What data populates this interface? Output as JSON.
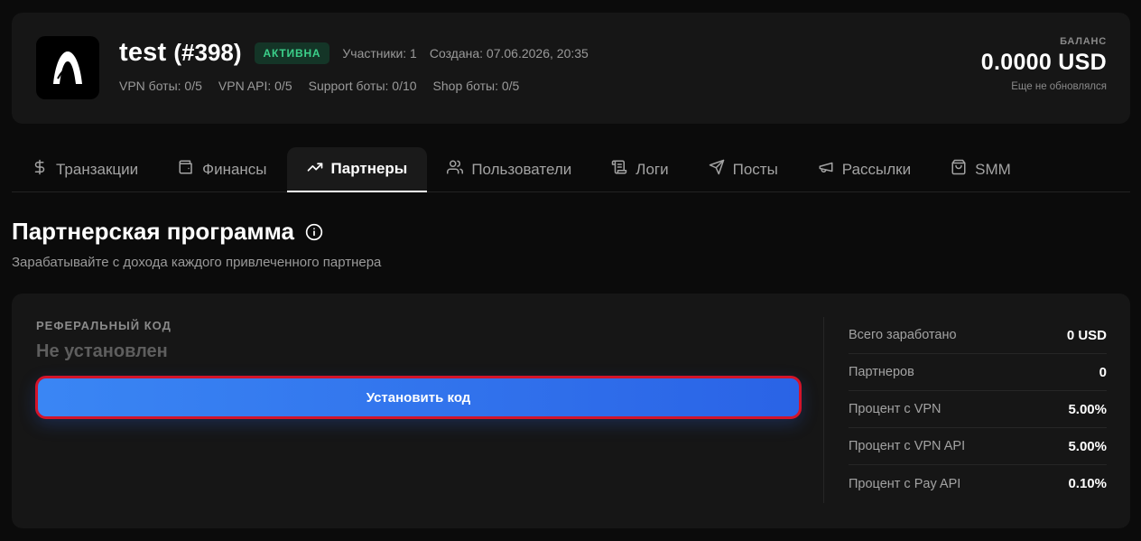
{
  "project": {
    "name": "test",
    "id": "(#398)",
    "status": "АКТИВНА",
    "members": "Участники: 1",
    "created": "Создана: 07.06.2026, 20:35",
    "limits": [
      "VPN боты: 0/5",
      "VPN API: 0/5",
      "Support боты: 0/10",
      "Shop боты: 0/5"
    ],
    "logo_icon": "arch-logo-icon"
  },
  "balance": {
    "label": "БАЛАНС",
    "value": "0.0000 USD",
    "note": "Еще не обновлялся"
  },
  "tabs": [
    {
      "label": "Транзакции",
      "icon": "dollar-icon",
      "active": false
    },
    {
      "label": "Финансы",
      "icon": "wallet-icon",
      "active": false
    },
    {
      "label": "Партнеры",
      "icon": "trending-up-icon",
      "active": true
    },
    {
      "label": "Пользователи",
      "icon": "users-icon",
      "active": false
    },
    {
      "label": "Логи",
      "icon": "scroll-icon",
      "active": false
    },
    {
      "label": "Посты",
      "icon": "send-icon",
      "active": false
    },
    {
      "label": "Рассылки",
      "icon": "megaphone-icon",
      "active": false
    },
    {
      "label": "SMM",
      "icon": "shopping-bag-icon",
      "active": false
    }
  ],
  "section": {
    "title": "Партнерская программа",
    "subtitle": "Зарабатывайте с дохода каждого привлеченного партнера",
    "info_icon": "info-icon"
  },
  "referral": {
    "label": "РЕФЕРАЛЬНЫЙ КОД",
    "value": "Не установлен",
    "button_label": "Установить код"
  },
  "stats": [
    {
      "label": "Всего заработано",
      "value": "0 USD"
    },
    {
      "label": "Партнеров",
      "value": "0"
    },
    {
      "label": "Процент с VPN",
      "value": "5.00%"
    },
    {
      "label": "Процент с VPN API",
      "value": "5.00%"
    },
    {
      "label": "Процент с Pay API",
      "value": "0.10%"
    }
  ],
  "colors": {
    "background": "#0b0b0b",
    "card": "#161616",
    "accent_blue": "#3a86f4",
    "status_green": "#3bd08a",
    "highlight_red": "#d3142a"
  }
}
